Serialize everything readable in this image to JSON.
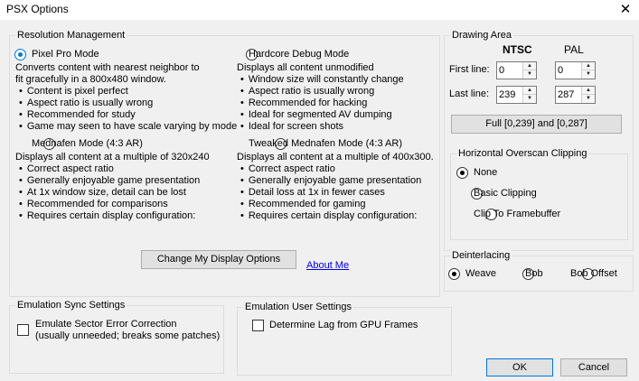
{
  "window": {
    "title": "PSX Options"
  },
  "resolution": {
    "legend": "Resolution Management",
    "pixel_pro": {
      "label": "Pixel Pro Mode",
      "desc1": "Converts content with nearest neighbor to",
      "desc2": "fit gracefully in a 800x480 window.",
      "bullets": [
        "Content is pixel perfect",
        "Aspect ratio is usually wrong",
        "Recommended for study",
        "Game may seen to have scale varying by mode"
      ],
      "selected": true
    },
    "hardcore": {
      "label": "Hardcore Debug Mode",
      "desc1": "Displays all content unmodified",
      "bullets": [
        "Window size will constantly change",
        "Aspect ratio is usually wrong",
        "Recommended for hacking",
        "Ideal for segmented AV dumping",
        "Ideal for screen shots"
      ],
      "selected": false
    },
    "mednafen": {
      "label": "Mednafen Mode (4:3 AR)",
      "desc1": "Displays all content at a multiple of 320x240",
      "bullets": [
        "Correct aspect ratio",
        "Generally enjoyable game presentation",
        "At 1x window size, detail can be lost",
        "Recommended for comparisons",
        "Requires certain display configuration:"
      ],
      "selected": false
    },
    "tweaked": {
      "label": "Tweaked Mednafen Mode (4:3 AR)",
      "desc1": "Displays all content at a multiple of 400x300.",
      "bullets": [
        "Correct aspect ratio",
        "Generally enjoyable game presentation",
        "Detail loss at 1x in fewer cases",
        "Recommended for gaming",
        "Requires certain display configuration:"
      ],
      "selected": false
    },
    "change_button": "Change My Display Options",
    "about_link": "About Me"
  },
  "drawing_area": {
    "legend": "Drawing Area",
    "ntsc_header": "NTSC",
    "pal_header": "PAL",
    "first_line_label": "First line:",
    "last_line_label": "Last line:",
    "ntsc_first": "0",
    "pal_first": "0",
    "ntsc_last": "239",
    "pal_last": "287",
    "full_button": "Full [0,239] and [0,287]"
  },
  "overscan": {
    "legend": "Horizontal Overscan Clipping",
    "options": [
      "None",
      "Basic Clipping",
      "Clip To Framebuffer"
    ],
    "selected_index": 0
  },
  "deinterlacing": {
    "legend": "Deinterlacing",
    "options": [
      "Weave",
      "Bob",
      "Bob Offset"
    ],
    "selected_index": 0
  },
  "sync": {
    "legend": "Emulation Sync Settings",
    "checkbox_line1": "Emulate Sector Error Correction",
    "checkbox_line2": "(usually unneeded; breaks some patches)",
    "checked": false
  },
  "user_settings": {
    "legend": "Emulation User Settings",
    "checkbox_label": "Determine Lag from GPU Frames",
    "checked": false
  },
  "buttons": {
    "ok": "OK",
    "cancel": "Cancel"
  }
}
